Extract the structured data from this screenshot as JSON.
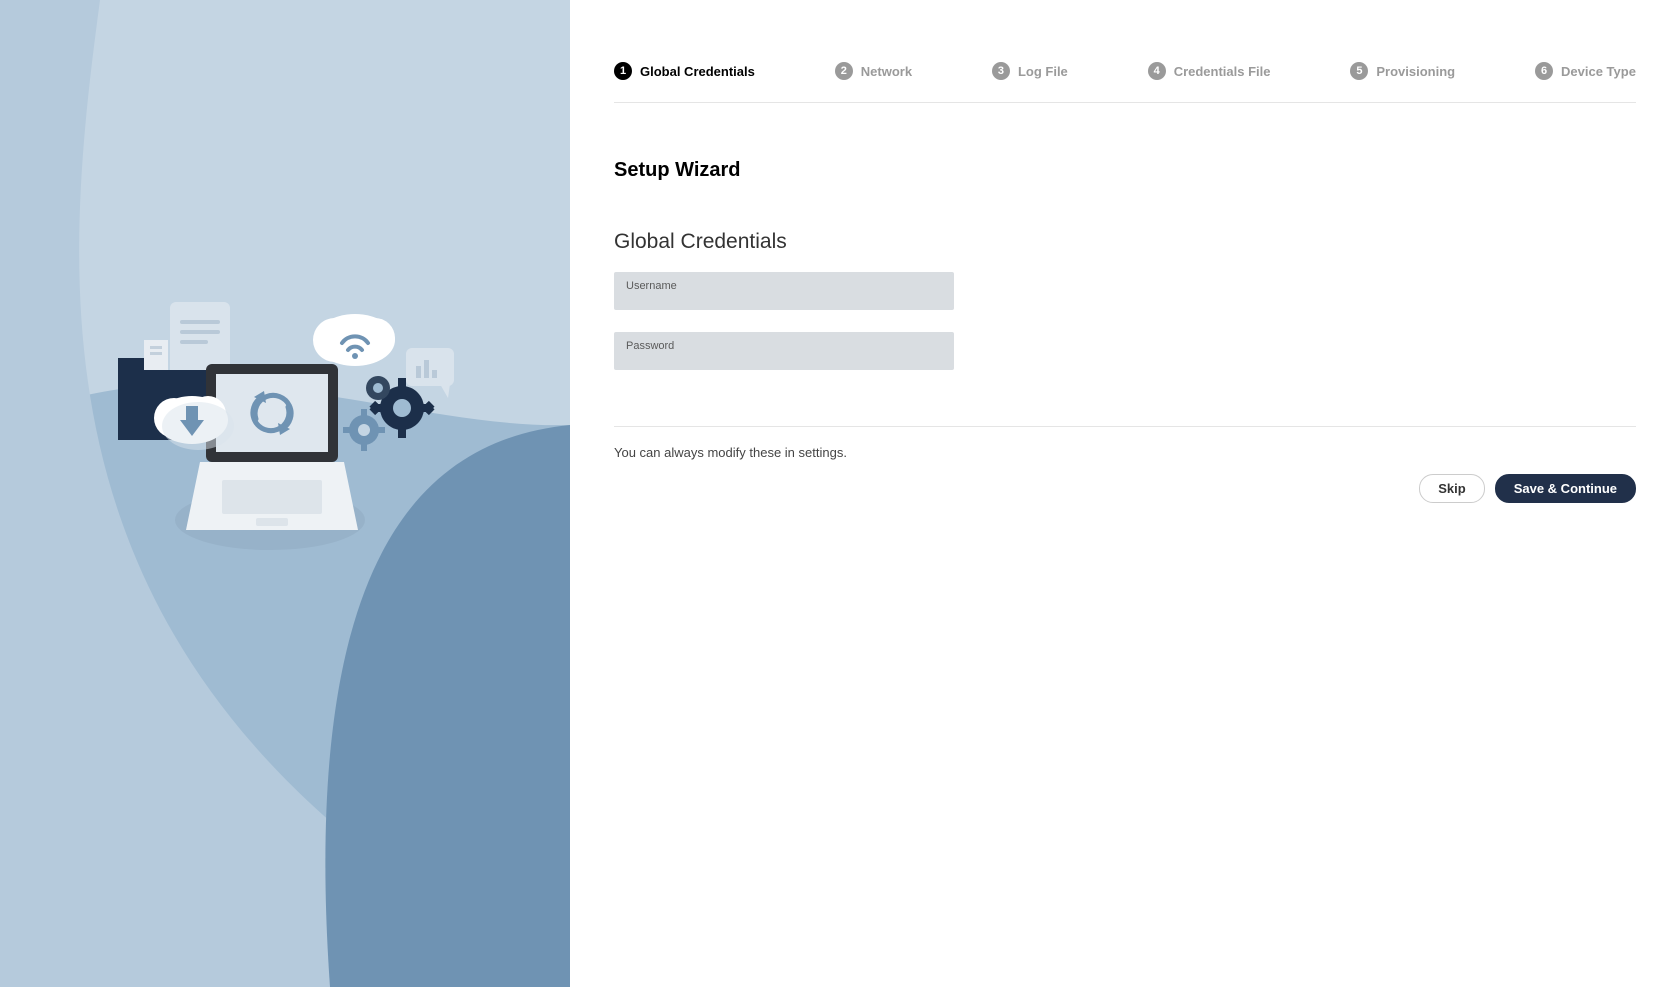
{
  "stepper": {
    "steps": [
      {
        "num": "1",
        "label": "Global Credentials",
        "state": "active"
      },
      {
        "num": "2",
        "label": "Network",
        "state": "inactive"
      },
      {
        "num": "3",
        "label": "Log File",
        "state": "inactive"
      },
      {
        "num": "4",
        "label": "Credentials File",
        "state": "inactive"
      },
      {
        "num": "5",
        "label": "Provisioning",
        "state": "inactive"
      },
      {
        "num": "6",
        "label": "Device Type",
        "state": "inactive"
      }
    ]
  },
  "page_title": "Setup Wizard",
  "section_title": "Global Credentials",
  "fields": {
    "username": {
      "label": "Username",
      "value": ""
    },
    "password": {
      "label": "Password",
      "value": ""
    }
  },
  "hint": "You can always modify these in settings.",
  "actions": {
    "skip": "Skip",
    "save": "Save & Continue"
  },
  "colors": {
    "left_bg": "#9fbbd2",
    "primary_btn": "#21304a"
  }
}
